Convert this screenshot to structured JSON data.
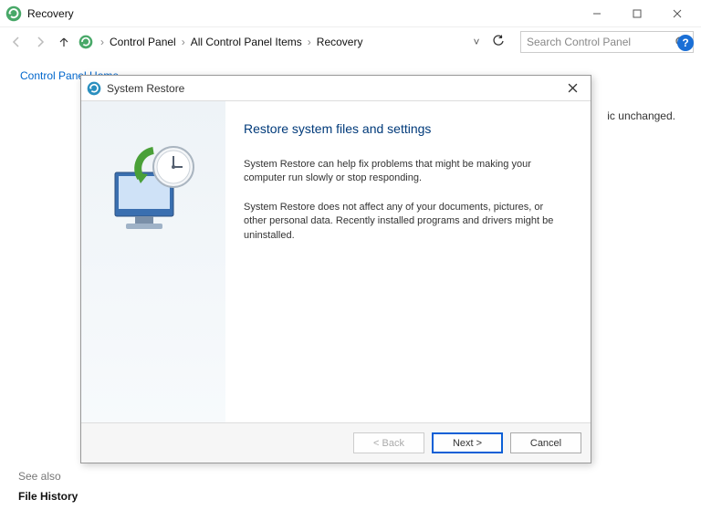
{
  "window": {
    "title": "Recovery",
    "min_label": "Minimize",
    "max_label": "Maximize",
    "close_label": "Close"
  },
  "nav": {
    "back_label": "Back",
    "forward_label": "Forward",
    "up_label": "Up",
    "crumbs": [
      "Control Panel",
      "All Control Panel Items",
      "Recovery"
    ],
    "refresh_label": "Refresh",
    "search_placeholder": "Search Control Panel"
  },
  "sidebar": {
    "home_link": "Control Panel Home",
    "see_also": "See also",
    "file_history": "File History"
  },
  "help_tooltip": "?",
  "bg_partial_text": "ic unchanged.",
  "dialog": {
    "title": "System Restore",
    "heading": "Restore system files and settings",
    "para1": "System Restore can help fix problems that might be making your computer run slowly or stop responding.",
    "para2": "System Restore does not affect any of your documents, pictures, or other personal data. Recently installed programs and drivers might be uninstalled.",
    "back_btn": "< Back",
    "next_btn": "Next >",
    "cancel_btn": "Cancel",
    "close_label": "Close"
  }
}
